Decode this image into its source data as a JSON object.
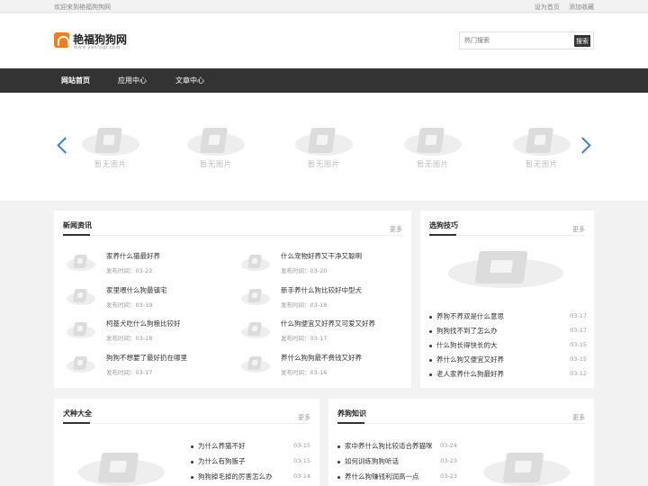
{
  "topbar": {
    "welcome": "欢迎来到艳福狗狗网",
    "set_home": "设为首页",
    "add_fav": "添加收藏"
  },
  "header": {
    "logo_name": "艳福狗狗网",
    "logo_sub": "www.yanfugl.com",
    "search_placeholder": "热门搜索",
    "search_button": "搜索"
  },
  "nav": {
    "items": [
      "网站首页",
      "应用中心",
      "文章中心"
    ]
  },
  "placeholder_text": "暂无图片",
  "news": {
    "title": "新闻资讯",
    "more": "更多",
    "date_prefix": "发布时间：",
    "items": [
      {
        "title": "家养什么猫最好养",
        "date": "发布时间：03-22"
      },
      {
        "title": "什么宠物好养又干净又聪明",
        "date": "发布时间：03-20"
      },
      {
        "title": "家里喂什么狗最镇宅",
        "date": "发布时间：03-19"
      },
      {
        "title": "新手养什么狗比较好中型犬",
        "date": "发布时间：03-18"
      },
      {
        "title": "柯基犬吃什么狗粮比较好",
        "date": "发布时间：03-18"
      },
      {
        "title": "什么狗便宜又好养又可爱又好养",
        "date": "发布时间：03-17"
      },
      {
        "title": "狗狗不想要了最好扔在哪里",
        "date": "发布时间：03-17"
      },
      {
        "title": "养什么狗狗最不费钱又好养",
        "date": "发布时间：03-16"
      }
    ]
  },
  "tips": {
    "title": "选狗技巧",
    "more": "更多",
    "items": [
      {
        "title": "养狗不养双是什么意思",
        "date": "03-17"
      },
      {
        "title": "狗狗找不到了怎么办",
        "date": "03-17"
      },
      {
        "title": "什么狗长得快长的大",
        "date": "03-15"
      },
      {
        "title": "养什么狗又便宜又好养",
        "date": "03-15"
      },
      {
        "title": "老人家养什么狗最好养",
        "date": "03-12"
      }
    ]
  },
  "breeds": {
    "title": "犬种大全",
    "more": "更多",
    "items": [
      {
        "title": "为什么养猫不好",
        "date": "03-15"
      },
      {
        "title": "为什么有狗贩子",
        "date": "03-15"
      },
      {
        "title": "狗狗掉毛掉的厉害怎么办",
        "date": "03-14"
      }
    ]
  },
  "knowledge": {
    "title": "养狗知识",
    "more": "更多",
    "items": [
      {
        "title": "家中养什么狗比较适合养猫咪",
        "date": "03-24"
      },
      {
        "title": "如何训练狗狗听话",
        "date": "03-23"
      },
      {
        "title": "养什么狗赚钱利润高一点",
        "date": "03-23"
      }
    ]
  }
}
